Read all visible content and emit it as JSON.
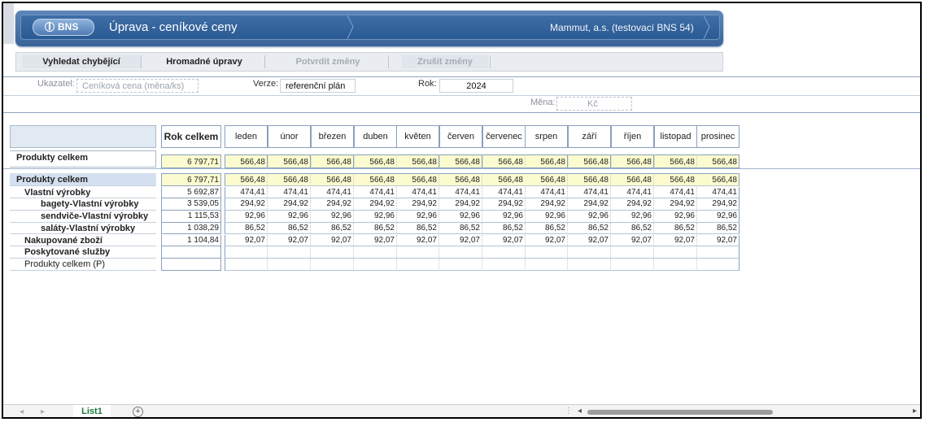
{
  "app": {
    "logo": "BNS",
    "title": "Úprava - ceníkové ceny",
    "company": "Mammut, a.s. (testovací BNS 54)"
  },
  "toolbar": {
    "find_errors": "Vyhledat chybějící",
    "bulk_edit": "Hromadné úpravy",
    "confirm": "Potvrdit změny",
    "cancel": "Zrušit změny"
  },
  "params": {
    "indicator_label": "Ukazatel:",
    "indicator_value": "Ceníková cena (měna/ks)",
    "version_label": "Verze:",
    "version_value": "referenční plán",
    "year_label": "Rok:",
    "year_value": "2024",
    "currency_label": "Měna:",
    "currency_value": "Kč"
  },
  "table": {
    "total_header": "Rok celkem",
    "months": [
      "leden",
      "únor",
      "březen",
      "duben",
      "květen",
      "červen",
      "červenec",
      "srpen",
      "září",
      "říjen",
      "listopad",
      "prosinec"
    ],
    "summary_row": {
      "label": "Produkty celkem",
      "total": "6 797,71",
      "value": "566,48"
    },
    "rows": [
      {
        "label": "Produkty celkem",
        "indent": 0,
        "bold": true,
        "total": "6 797,71",
        "value": "566,48",
        "highlight": true
      },
      {
        "label": "Vlastní výrobky",
        "indent": 1,
        "bold": true,
        "total": "5 692,87",
        "value": "474,41"
      },
      {
        "label": "bagety-Vlastní výrobky",
        "indent": 2,
        "bold": true,
        "total": "3 539,05",
        "value": "294,92"
      },
      {
        "label": "sendviče-Vlastní výrobky",
        "indent": 2,
        "bold": true,
        "total": "1 115,53",
        "value": "92,96"
      },
      {
        "label": "saláty-Vlastní výrobky",
        "indent": 2,
        "bold": true,
        "total": "1 038,29",
        "value": "86,52"
      },
      {
        "label": "Nakupované zboží",
        "indent": 1,
        "bold": true,
        "total": "1 104,84",
        "value": "92,07"
      },
      {
        "label": "Poskytované služby",
        "indent": 1,
        "bold": true,
        "total": "",
        "value": ""
      },
      {
        "label": "Produkty celkem (P)",
        "indent": 1,
        "bold": false,
        "total": "",
        "value": ""
      }
    ]
  },
  "sheet": {
    "tab": "List1",
    "add": "+"
  }
}
